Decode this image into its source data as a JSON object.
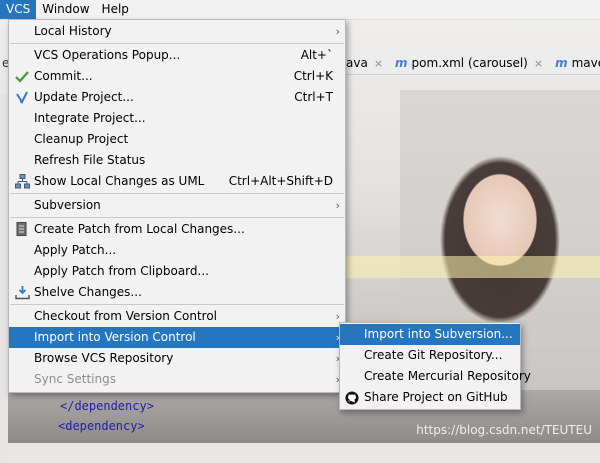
{
  "menubar": {
    "items": [
      {
        "label": "VCS",
        "active": true
      },
      {
        "label": "Window",
        "active": false
      },
      {
        "label": "Help",
        "active": false
      }
    ]
  },
  "editor": {
    "left_tab_fragment": "er",
    "tabs": [
      {
        "label": "ava",
        "close": "×"
      },
      {
        "label": "pom.xml (carousel)",
        "icon": "m",
        "close": "×"
      },
      {
        "label": "mave",
        "icon": "m"
      }
    ],
    "code_lines": [
      {
        "text": "</dependency>"
      },
      {
        "text": "<dependency>"
      }
    ],
    "watermark": "https://blog.csdn.net/TEUTEU"
  },
  "vcs_menu": {
    "local_history": "Local History",
    "operations_popup": {
      "label": "VCS Operations Popup...",
      "shortcut": "Alt+`"
    },
    "commit": {
      "label": "Commit...",
      "shortcut": "Ctrl+K",
      "icon": "check-icon"
    },
    "update_project": {
      "label": "Update Project...",
      "shortcut": "Ctrl+T",
      "icon": "update-arrow-icon"
    },
    "integrate_project": "Integrate Project...",
    "cleanup_project": "Cleanup Project",
    "refresh_file_status": "Refresh File Status",
    "show_local_changes_uml": {
      "label": "Show Local Changes as UML",
      "shortcut": "Ctrl+Alt+Shift+D",
      "icon": "uml-diagram-icon"
    },
    "subversion": "Subversion",
    "create_patch": {
      "label": "Create Patch from Local Changes...",
      "icon": "patch-icon"
    },
    "apply_patch": "Apply Patch...",
    "apply_patch_clipboard": "Apply Patch from Clipboard...",
    "shelve_changes": {
      "label": "Shelve Changes...",
      "icon": "shelve-icon"
    },
    "checkout": "Checkout from Version Control",
    "import_into_vc": "Import into Version Control",
    "browse_vcs": "Browse VCS Repository",
    "sync_settings": "Sync Settings",
    "arrow_glyph": "›"
  },
  "import_submenu": {
    "items": [
      {
        "label": "Import into Subversion...",
        "highlight": true
      },
      {
        "label": "Create Git Repository..."
      },
      {
        "label": "Create Mercurial Repository"
      },
      {
        "label": "Share Project on GitHub",
        "icon": "github-icon"
      }
    ]
  },
  "colors": {
    "highlight": "#2675bf",
    "menu_bg": "#f2f2f2",
    "check_green": "#3d9a3d",
    "update_blue": "#2f7bd1"
  }
}
